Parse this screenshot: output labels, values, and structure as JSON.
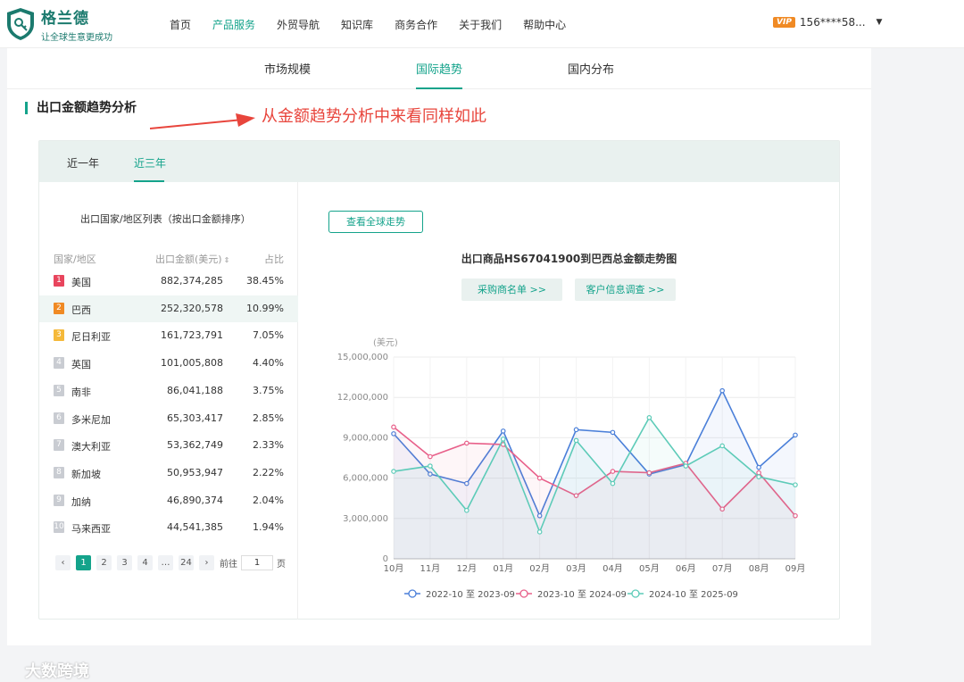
{
  "brand": {
    "name": "格兰德",
    "slogan": "让全球生意更成功"
  },
  "nav": [
    "首页",
    "产品服务",
    "外贸导航",
    "知识库",
    "商务合作",
    "关于我们",
    "帮助中心"
  ],
  "nav_active": 1,
  "user": {
    "vip": "VIP",
    "phone": "156****58..."
  },
  "subtabs": [
    "市场规模",
    "国际趋势",
    "国内分布"
  ],
  "section_title": "出口金额趋势分析",
  "annotation": "从金额趋势分析中来看同样如此",
  "periods": [
    "近一年",
    "近三年"
  ],
  "list_title": "出口国家/地区列表（按出口金额排序）",
  "headers": {
    "country": "国家/地区",
    "amount": "出口金额(美元)",
    "ratio": "占比"
  },
  "rows": [
    {
      "rank": "1",
      "country": "美国",
      "amount": "882,374,285",
      "ratio": "38.45%",
      "color": "#e8455d"
    },
    {
      "rank": "2",
      "country": "巴西",
      "amount": "252,320,578",
      "ratio": "10.99%",
      "color": "#f08a24"
    },
    {
      "rank": "3",
      "country": "尼日利亚",
      "amount": "161,723,791",
      "ratio": "7.05%",
      "color": "#f5b93a"
    },
    {
      "rank": "4",
      "country": "英国",
      "amount": "101,005,808",
      "ratio": "4.40%",
      "color": "#c9ccd2"
    },
    {
      "rank": "5",
      "country": "南非",
      "amount": "86,041,188",
      "ratio": "3.75%",
      "color": "#c9ccd2"
    },
    {
      "rank": "6",
      "country": "多米尼加",
      "amount": "65,303,417",
      "ratio": "2.85%",
      "color": "#c9ccd2"
    },
    {
      "rank": "7",
      "country": "澳大利亚",
      "amount": "53,362,749",
      "ratio": "2.33%",
      "color": "#c9ccd2"
    },
    {
      "rank": "8",
      "country": "新加坡",
      "amount": "50,953,947",
      "ratio": "2.22%",
      "color": "#c9ccd2"
    },
    {
      "rank": "9",
      "country": "加纳",
      "amount": "46,890,374",
      "ratio": "2.04%",
      "color": "#c9ccd2"
    },
    {
      "rank": "10",
      "country": "马来西亚",
      "amount": "44,541,385",
      "ratio": "1.94%",
      "color": "#c9ccd2"
    }
  ],
  "pager": {
    "prev": "‹",
    "pages": [
      "1",
      "2",
      "3",
      "4",
      "…",
      "24"
    ],
    "next": "›",
    "goto_label": "前往",
    "goto_value": "1",
    "page_unit": "页"
  },
  "global_button": "查看全球走势",
  "chart_title": "出口商品HS67041900到巴西总金额走势图",
  "chips": [
    "采购商名单 >>",
    "客户信息调查 >>"
  ],
  "watermark": "大数跨境",
  "chart_data": {
    "type": "line",
    "unit": "(美元)",
    "categories": [
      "10月",
      "11月",
      "12月",
      "01月",
      "02月",
      "03月",
      "04月",
      "05月",
      "06月",
      "07月",
      "08月",
      "09月"
    ],
    "ylim": [
      0,
      15000000
    ],
    "yticks": [
      "0",
      "3,000,000",
      "6,000,000",
      "9,000,000",
      "12,000,000",
      "15,000,000"
    ],
    "series": [
      {
        "name": "2022-10 至 2023-09",
        "color": "#4a7fd9",
        "values": [
          9300000,
          6300000,
          5600000,
          9500000,
          3200000,
          9600000,
          9400000,
          6300000,
          7000000,
          12500000,
          6800000,
          9200000
        ]
      },
      {
        "name": "2023-10 至 2024-09",
        "color": "#e8608a",
        "values": [
          9800000,
          7600000,
          8600000,
          8500000,
          6000000,
          4700000,
          6500000,
          6400000,
          7100000,
          3700000,
          6400000,
          3200000
        ]
      },
      {
        "name": "2024-10 至 2025-09",
        "color": "#5dcbb8",
        "values": [
          6500000,
          6900000,
          3600000,
          8900000,
          2000000,
          8800000,
          5600000,
          10500000,
          6900000,
          8400000,
          6100000,
          5500000
        ]
      }
    ]
  }
}
